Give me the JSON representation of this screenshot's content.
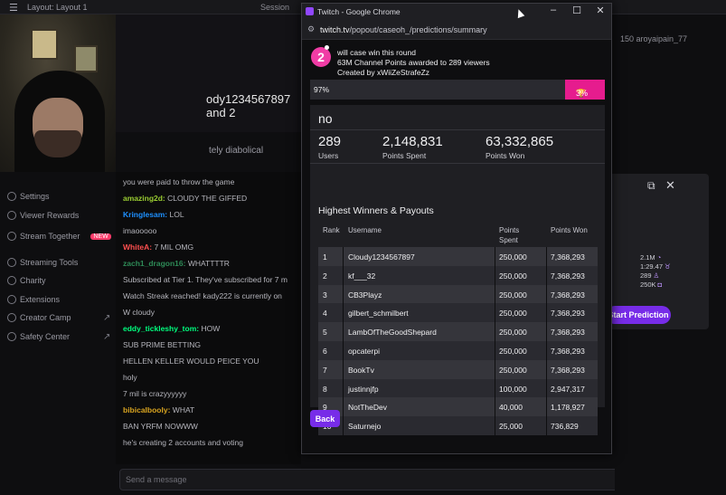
{
  "background": {
    "topbar": {
      "menu_glyph": "☰",
      "layout_label": "Layout: Layout 1",
      "session_label": "Session"
    },
    "stream_text": {
      "headline": "ody1234567897 and 2",
      "sub": "tely diabolical"
    },
    "sidebar": {
      "items": [
        {
          "label": "Settings"
        },
        {
          "label": "Viewer Rewards"
        },
        {
          "label": "Stream Together",
          "badge": "NEW"
        },
        {
          "label": "Streaming Tools"
        },
        {
          "label": "Charity"
        },
        {
          "label": "Extensions"
        },
        {
          "label": "Creator Camp"
        },
        {
          "label": "Safety Center"
        }
      ]
    },
    "chat": [
      {
        "user": "",
        "msg": "you were paid to throw the game",
        "color": "#ff4f4f"
      },
      {
        "user": "amazing2d:",
        "msg": "CLOUDY THE GIFFED",
        "color": "#9acd32"
      },
      {
        "user": "Kringlesam:",
        "msg": "LOL",
        "color": "#1e90ff"
      },
      {
        "user": "",
        "msg": "imaooooo",
        "color": "#ff7f50"
      },
      {
        "user": "WhiteA:",
        "msg": "7 MIL OMG",
        "color": "#ff4f4f"
      },
      {
        "user": "zach1_dragon16:",
        "msg": "WHATTTTR",
        "color": "#2e8b57"
      },
      {
        "user": "",
        "msg": "Subscribed at Tier 1. They've subscribed for 7 m",
        "color": "#bf94ff"
      },
      {
        "user": "",
        "msg": "Watch Streak reached! kady222 is currently on",
        "color": "#bf94ff"
      },
      {
        "user": "",
        "msg": "W cloudy",
        "color": "#1e90ff"
      },
      {
        "user": "eddy_tickleshy_tom:",
        "msg": "HOW",
        "color": "#00ff7f"
      },
      {
        "user": "",
        "msg": "SUB PRIME BETTING",
        "color": "#1e90ff"
      },
      {
        "user": "",
        "msg": "HELLEN KELLER WOULD PEICE YOU",
        "color": "#ff4500"
      },
      {
        "user": "",
        "msg": "holy",
        "color": "#ff69b4"
      },
      {
        "user": "",
        "msg": "7 mil is crazyyyyyy",
        "color": "#2e8b57"
      },
      {
        "user": "bibicalbooly:",
        "msg": "WHAT",
        "color": "#daa520"
      },
      {
        "user": "",
        "msg": "BAN YRFM NOWWW",
        "color": "#1e90ff"
      },
      {
        "user": "",
        "msg": "he's creating 2 accounts and voting",
        "color": "#ff69b4"
      }
    ],
    "chat_placeholder": "Send a message",
    "right_top": "150   aroyaipain_77",
    "panel_stats": [
      "2.1M",
      "1:29.47",
      "289",
      "250K"
    ],
    "start_prediction_label": "Start Prediction"
  },
  "browser": {
    "window_title": "Twitch - Google Chrome",
    "url_host": "twitch.tv",
    "url_path": "/popout/caseoh_/predictions/summary"
  },
  "prediction": {
    "outcome_number": "2",
    "lines": [
      "will case win this round",
      "63M Channel Points awarded to 289 viewers",
      "Created by xWiiZeStrafeZz"
    ],
    "bar": {
      "blue_pct": 97,
      "blue_label": "97%",
      "pink_label": "3%",
      "blue_color": "#2a2a30",
      "pink_color": "#e61c8e"
    },
    "outcome_title": "no",
    "stats": [
      {
        "value": "289",
        "label": "Users"
      },
      {
        "value": "2,148,831",
        "label": "Points Spent"
      },
      {
        "value": "63,332,865",
        "label": "Points Won"
      }
    ],
    "section_title": "Highest Winners & Payouts",
    "columns": {
      "rank": "Rank",
      "username": "Username",
      "spent": "Points Spent",
      "won": "Points Won"
    },
    "rows": [
      {
        "rank": "1",
        "username": "Cloudy1234567897",
        "spent": "250,000",
        "won": "7,368,293"
      },
      {
        "rank": "2",
        "username": "kf___32",
        "spent": "250,000",
        "won": "7,368,293"
      },
      {
        "rank": "3",
        "username": "CB3Playz",
        "spent": "250,000",
        "won": "7,368,293"
      },
      {
        "rank": "4",
        "username": "gilbert_schmilbert",
        "spent": "250,000",
        "won": "7,368,293"
      },
      {
        "rank": "5",
        "username": "LambOfTheGoodShepard",
        "spent": "250,000",
        "won": "7,368,293"
      },
      {
        "rank": "6",
        "username": "opcaterpi",
        "spent": "250,000",
        "won": "7,368,293"
      },
      {
        "rank": "7",
        "username": "BookTv",
        "spent": "250,000",
        "won": "7,368,293"
      },
      {
        "rank": "8",
        "username": "justinnjfp",
        "spent": "100,000",
        "won": "2,947,317"
      },
      {
        "rank": "9",
        "username": "NotTheDev",
        "spent": "40,000",
        "won": "1,178,927"
      },
      {
        "rank": "10",
        "username": "Saturnejo",
        "spent": "25,000",
        "won": "736,829"
      }
    ],
    "back_label": "Back",
    "accent_color": "#772ce8"
  }
}
